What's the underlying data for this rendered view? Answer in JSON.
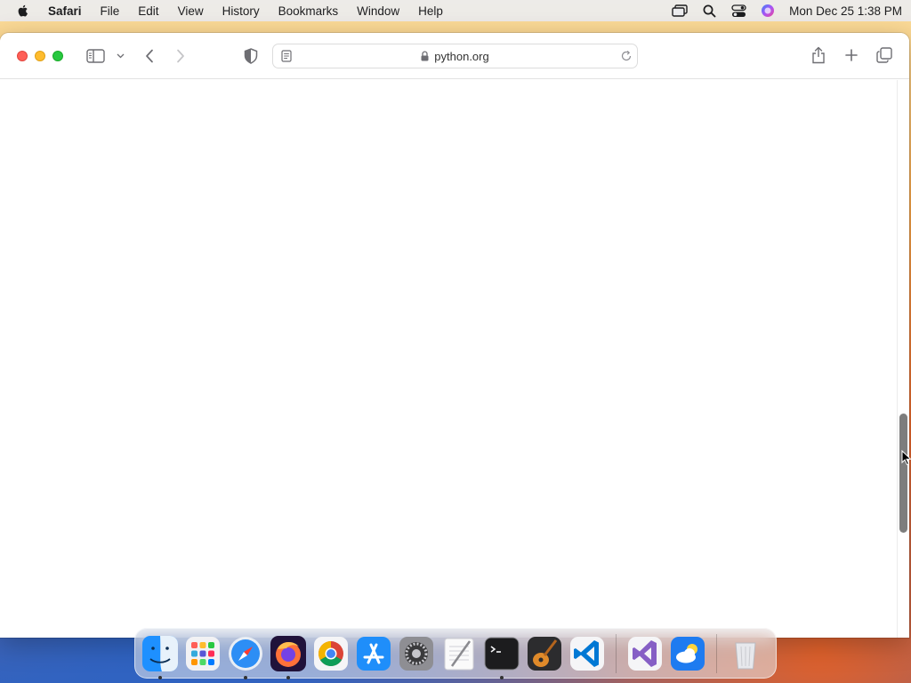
{
  "menubar": {
    "app": "Safari",
    "items": [
      "File",
      "Edit",
      "View",
      "History",
      "Bookmarks",
      "Window",
      "Help"
    ],
    "clock": "Mon Dec 25  1:38 PM"
  },
  "browser": {
    "url": "python.org"
  },
  "dock": {
    "apps": [
      {
        "name": "Finder",
        "icon": "finder-icon",
        "running": true
      },
      {
        "name": "Launchpad",
        "icon": "launchpad-icon",
        "running": false
      },
      {
        "name": "Safari",
        "icon": "safari-icon",
        "running": true
      },
      {
        "name": "Firefox",
        "icon": "firefox-icon",
        "running": true
      },
      {
        "name": "Chrome",
        "icon": "chrome-icon",
        "running": false
      },
      {
        "name": "App Store",
        "icon": "app-store-icon",
        "running": false
      },
      {
        "name": "System Settings",
        "icon": "system-settings-icon",
        "running": false
      },
      {
        "name": "TextEdit",
        "icon": "textedit-icon",
        "running": false
      },
      {
        "name": "Terminal",
        "icon": "terminal-icon",
        "running": true
      },
      {
        "name": "GarageBand",
        "icon": "garageband-icon",
        "running": false
      },
      {
        "name": "Visual Studio Code",
        "icon": "vscode-icon",
        "running": false
      }
    ],
    "recent": [
      {
        "name": "Visual Studio",
        "icon": "visual-studio-icon"
      },
      {
        "name": "Weather",
        "icon": "weather-icon"
      }
    ],
    "trash": {
      "name": "Trash",
      "icon": "trash-icon"
    }
  },
  "colors": {
    "close": "#ff5f57",
    "minimize": "#febc2e",
    "maximize": "#28c840"
  }
}
